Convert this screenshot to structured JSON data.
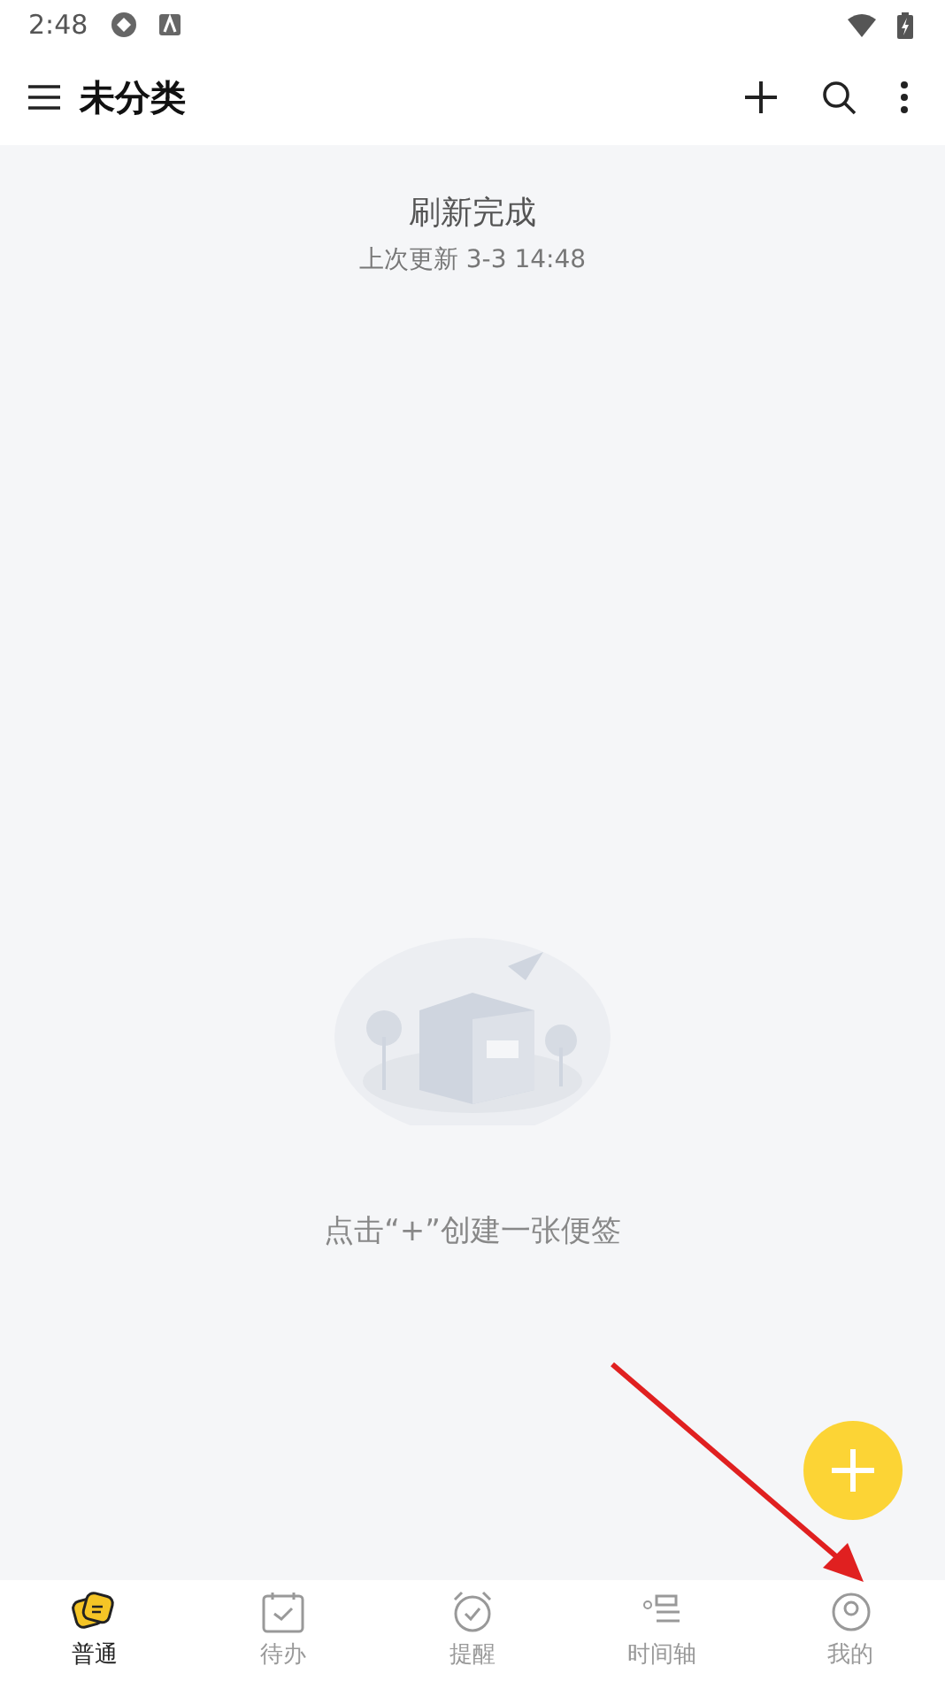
{
  "status_bar": {
    "time": "2:48"
  },
  "header": {
    "title": "未分类"
  },
  "refresh": {
    "title": "刷新完成",
    "subtitle": "上次更新 3-3 14:48"
  },
  "empty_state": {
    "message": "点击“+”创建一张便签"
  },
  "tabs": [
    {
      "label": "普通",
      "kind": "notes",
      "selected": true
    },
    {
      "label": "待办",
      "kind": "todo",
      "selected": false
    },
    {
      "label": "提醒",
      "kind": "alarm",
      "selected": false
    },
    {
      "label": "时间轴",
      "kind": "timeline",
      "selected": false
    },
    {
      "label": "我的",
      "kind": "profile",
      "selected": false
    }
  ]
}
